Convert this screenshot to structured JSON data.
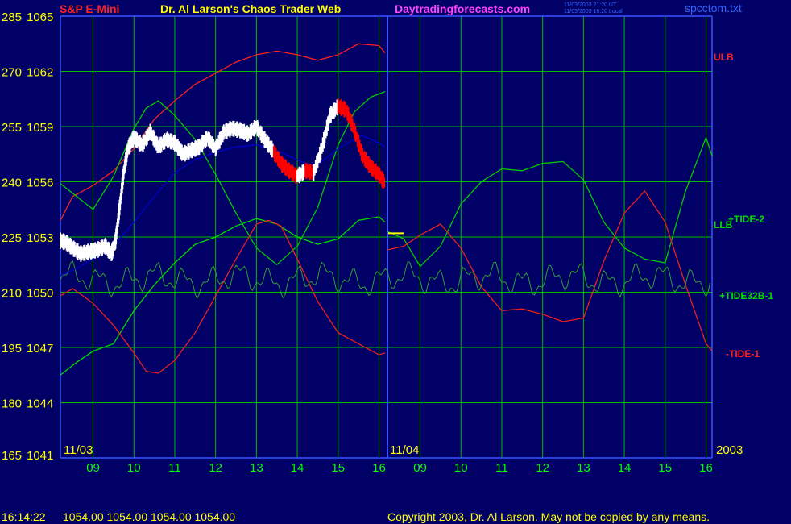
{
  "header": {
    "symbol": "S&P E-Mini",
    "author": "Dr. Al Larson's Chaos Trader Web",
    "site": "Daytradingforecasts.com",
    "stamp_1": "11/03/2003 21:20 UT",
    "stamp_2": "11/03/2003 16:20 Local",
    "file": "spcctom.txt"
  },
  "footer": {
    "time": "16:14:22",
    "quotes": "1054.00 1054.00 1054.00 1054.00",
    "copyright": "Copyright 2003, Dr. Al Larson. May not be copied by any means."
  },
  "chart_data": {
    "type": "line",
    "left_axis_outer_ticks": [
      "285",
      "270",
      "255",
      "240",
      "225",
      "210",
      "195",
      "180",
      "165"
    ],
    "left_axis_price_ticks": [
      "1065",
      "1062",
      "1059",
      "1056",
      "1053",
      "1050",
      "1047",
      "1044",
      "1041"
    ],
    "ylim": [
      1041,
      1065
    ],
    "date_labels": [
      "11/03",
      "11/04"
    ],
    "year_label": "2003",
    "x_tick_labels": [
      "09",
      "10",
      "11",
      "12",
      "13",
      "14",
      "15",
      "16",
      "09",
      "10",
      "11",
      "12",
      "13",
      "14",
      "15",
      "16"
    ],
    "day1_hours": [
      8.2,
      16.15
    ],
    "day2_hours": [
      8.2,
      16.15
    ],
    "price_series": {
      "hours": [
        8.2,
        8.35,
        8.5,
        8.7,
        8.9,
        9.1,
        9.3,
        9.45,
        9.55,
        9.65,
        9.75,
        9.85,
        10.0,
        10.2,
        10.4,
        10.6,
        10.8,
        11.0,
        11.2,
        11.4,
        11.6,
        11.8,
        12.0,
        12.2,
        12.4,
        12.6,
        12.8,
        13.0,
        13.2,
        13.4,
        13.6,
        13.8,
        14.0,
        14.2,
        14.4,
        14.6,
        14.8,
        15.0,
        15.2,
        15.4,
        15.6,
        15.8,
        16.0,
        16.15
      ],
      "values": [
        1052.8,
        1052.7,
        1052.4,
        1052.1,
        1052.2,
        1052.3,
        1052.5,
        1052.1,
        1052.8,
        1054.6,
        1056.5,
        1057.8,
        1058.4,
        1058.0,
        1058.7,
        1057.9,
        1058.3,
        1058.1,
        1057.5,
        1057.7,
        1057.9,
        1058.4,
        1057.8,
        1058.7,
        1058.9,
        1058.8,
        1058.6,
        1059.0,
        1058.3,
        1057.7,
        1057.0,
        1056.6,
        1056.3,
        1056.6,
        1056.5,
        1057.8,
        1059.6,
        1060.1,
        1059.9,
        1058.8,
        1057.4,
        1056.8,
        1056.4,
        1055.9
      ],
      "day2_value": 1053.2
    },
    "series": [
      {
        "name": "ULB",
        "color": "#ff2020",
        "hours": [
          8.2,
          8.5,
          9.0,
          9.5,
          10.0,
          10.5,
          11.0,
          11.5,
          12.0,
          12.5,
          13.0,
          13.5,
          14.0,
          14.5,
          15.0,
          15.5,
          16.0,
          16.15
        ],
        "values": [
          1053.9,
          1055.2,
          1055.8,
          1056.6,
          1057.8,
          1059.4,
          1060.4,
          1061.3,
          1061.9,
          1062.5,
          1062.9,
          1063.1,
          1062.9,
          1062.6,
          1062.9,
          1063.5,
          1063.4,
          1063.0
        ]
      },
      {
        "name": "LLB",
        "color": "#00dd00",
        "hours": [
          8.2,
          8.6,
          9.0,
          9.5,
          10.0,
          10.5,
          11.0,
          11.5,
          12.0,
          12.5,
          13.0,
          13.5,
          14.0,
          14.5,
          15.0,
          15.5,
          16.0,
          16.15
        ],
        "values": [
          1045.5,
          1046.2,
          1046.8,
          1047.2,
          1049.0,
          1050.4,
          1051.6,
          1052.6,
          1053.0,
          1053.6,
          1054.0,
          1053.7,
          1053.0,
          1052.6,
          1052.9,
          1053.9,
          1054.1,
          1053.8
        ]
      },
      {
        "name": "+TIDE-2",
        "color": "#00cc00",
        "hours": [
          8.2,
          9.0,
          9.5,
          10.0,
          10.3,
          10.6,
          11.0,
          11.5,
          12.0,
          12.5,
          13.0,
          13.5,
          14.0,
          14.5,
          15.0,
          15.4,
          15.8,
          16.15,
          16.2,
          16.6,
          17.0,
          17.5,
          18.0,
          18.5,
          19.0,
          19.5,
          20.0,
          20.5,
          21.0,
          21.5,
          22.0,
          22.5,
          23.0,
          23.5,
          24.0,
          24.15
        ],
        "values": [
          1055.9,
          1054.5,
          1056.3,
          1058.9,
          1060.0,
          1060.4,
          1059.6,
          1058.3,
          1056.4,
          1054.3,
          1052.4,
          1051.5,
          1052.5,
          1054.6,
          1058.0,
          1059.8,
          1060.6,
          1060.9,
          1053.3,
          1052.9,
          1051.4,
          1052.5,
          1054.8,
          1056.0,
          1056.7,
          1056.6,
          1057.0,
          1057.1,
          1056.1,
          1053.8,
          1052.4,
          1051.8,
          1051.6,
          1055.5,
          1058.4,
          1057.4
        ]
      },
      {
        "name": "-TIDE-1",
        "color": "#ee2020",
        "hours": [
          8.2,
          8.5,
          9.0,
          9.5,
          10.0,
          10.3,
          10.6,
          11.0,
          11.5,
          12.0,
          12.5,
          13.0,
          13.3,
          13.6,
          14.0,
          14.5,
          15.0,
          15.5,
          16.0,
          16.15,
          16.2,
          16.6,
          17.0,
          17.5,
          18.0,
          18.5,
          19.0,
          19.5,
          20.0,
          20.5,
          21.0,
          21.5,
          22.0,
          22.5,
          23.0,
          23.5,
          24.0,
          24.15
        ],
        "values": [
          1049.8,
          1050.2,
          1049.4,
          1048.2,
          1046.7,
          1045.7,
          1045.6,
          1046.3,
          1047.8,
          1049.8,
          1051.8,
          1053.7,
          1053.9,
          1053.6,
          1051.8,
          1049.5,
          1047.8,
          1047.2,
          1046.6,
          1046.7,
          1052.3,
          1052.5,
          1053.1,
          1053.7,
          1052.4,
          1050.3,
          1049.0,
          1049.1,
          1048.8,
          1048.4,
          1048.6,
          1051.7,
          1054.3,
          1055.5,
          1053.8,
          1050.4,
          1047.2,
          1046.8
        ]
      },
      {
        "name": "+TIDE32B-1",
        "color": "#30a030",
        "center": 1050.7,
        "amplitude": 0.9,
        "hours_range": [
          8.2,
          24.15
        ]
      },
      {
        "name": "",
        "color": "#0000cc",
        "hours": [
          8.2,
          8.6,
          9.0,
          9.5,
          10.0,
          10.5,
          11.0,
          11.5,
          12.0,
          12.5,
          13.0,
          13.5,
          14.0,
          14.3,
          14.6,
          15.0,
          15.3,
          15.6,
          16.0,
          16.15
        ],
        "values": [
          1050.9,
          1051.3,
          1051.8,
          1052.5,
          1053.8,
          1055.2,
          1056.5,
          1057.2,
          1057.6,
          1057.9,
          1058.0,
          1057.7,
          1057.2,
          1056.9,
          1057.1,
          1057.8,
          1058.2,
          1058.5,
          1058.1,
          1057.9
        ]
      }
    ],
    "series_labels": [
      {
        "text": "ULB",
        "color": "#ff2020"
      },
      {
        "text": "+TIDE-2",
        "color": "#00dd00"
      },
      {
        "text": "LLB",
        "color": "#00dd00"
      },
      {
        "text": "+TIDE32B-1",
        "color": "#00dd00"
      },
      {
        "text": "-TIDE-1",
        "color": "#ff2020"
      }
    ],
    "colors": {
      "background": "#000066",
      "grid": "#00bb00",
      "axis": "#3355ff",
      "price": "#ffffff",
      "price_down": "#ff0000",
      "ticks": "#00ff00",
      "axis_text": "#ffff00"
    }
  }
}
